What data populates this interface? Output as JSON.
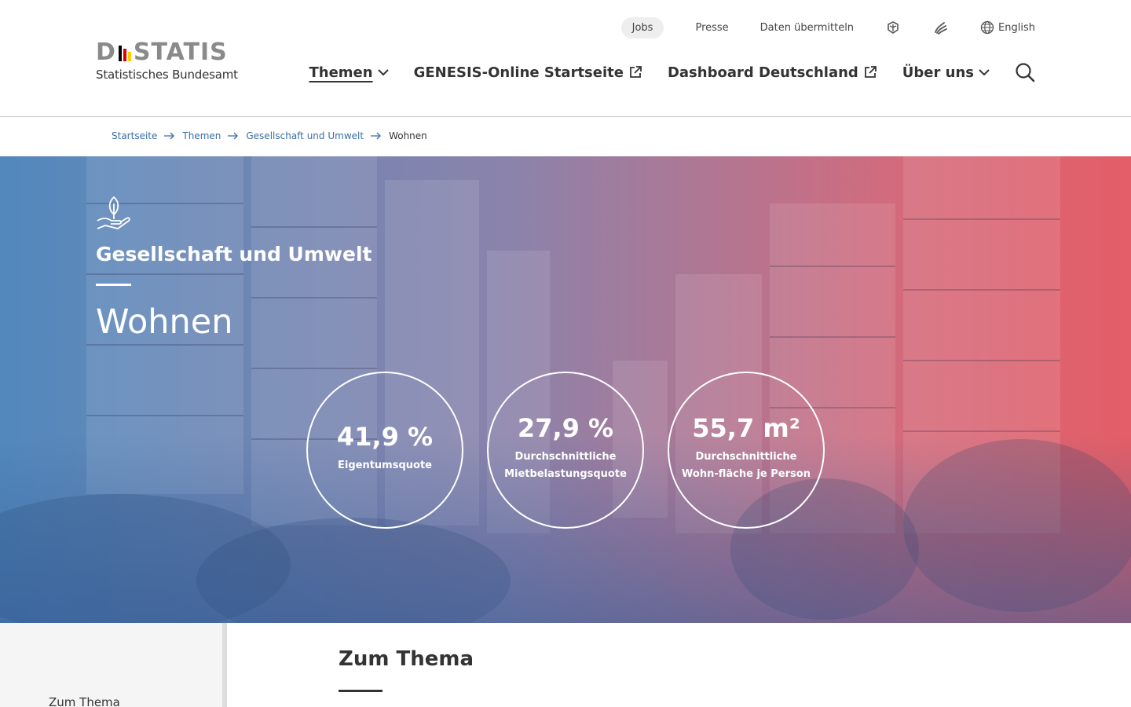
{
  "logo": {
    "brand": "DSTATIS",
    "brand_left": "D",
    "brand_right": "STATIS",
    "subtitle": "Statistisches Bundesamt",
    "flag_colors": [
      "#000000",
      "#dd0000",
      "#ffcc00"
    ]
  },
  "topnav": {
    "jobs": "Jobs",
    "presse": "Presse",
    "daten": "Daten übermitteln",
    "leichte_sprache_icon": "leichte-sprache-icon",
    "gebaerdensprache_icon": "gebaerdensprache-icon",
    "language": "English"
  },
  "mainnav": {
    "themen": "Themen",
    "genesis": "GENESIS-Online Startseite",
    "dashboard": "Dashboard Deutschland",
    "ueber": "Über uns"
  },
  "breadcrumb": {
    "items": [
      "Startseite",
      "Themen",
      "Gesellschaft und Umwelt"
    ],
    "current": "Wohnen"
  },
  "hero": {
    "category": "Gesellschaft und Umwelt",
    "title": "Wohnen",
    "stats": [
      {
        "value": "41,9 %",
        "label": "Eigentumsquote"
      },
      {
        "value": "27,9 %",
        "label": "Durchschnittliche Mietbelastungsquote"
      },
      {
        "value": "55,7 m²",
        "label": "Durchschnittliche Wohn-fläche je Person"
      }
    ]
  },
  "sidebar": {
    "item": "Zum Thema"
  },
  "content": {
    "title": "Zum Thema"
  },
  "colors": {
    "link": "#3a6ea5",
    "text": "#333333",
    "hero_left": "#4982b9",
    "hero_right": "#e1505a"
  }
}
